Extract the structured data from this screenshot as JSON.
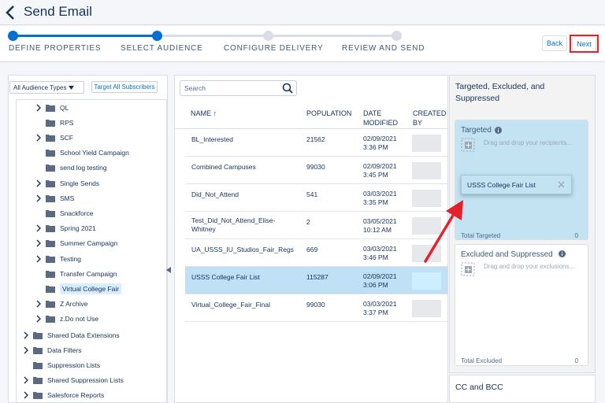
{
  "header": {
    "title": "Send Email"
  },
  "steps": [
    {
      "label": "DEFINE PROPERTIES",
      "state": "done"
    },
    {
      "label": "SELECT AUDIENCE",
      "state": "current"
    },
    {
      "label": "CONFIGURE DELIVERY",
      "state": "todo"
    },
    {
      "label": "REVIEW AND SEND",
      "state": "todo"
    }
  ],
  "actions": {
    "back_label": "Back",
    "next_label": "Next"
  },
  "tree": {
    "audience_select": "All Audience Types",
    "target_all_label": "Target All Subscribers",
    "items": [
      {
        "label": "QL",
        "expandable": true
      },
      {
        "label": "RPS",
        "expandable": false
      },
      {
        "label": "SCF",
        "expandable": true
      },
      {
        "label": "School Yield Campaign",
        "expandable": false
      },
      {
        "label": "send log testing",
        "expandable": false
      },
      {
        "label": "Single Sends",
        "expandable": true
      },
      {
        "label": "SMS",
        "expandable": true
      },
      {
        "label": "Snackforce",
        "expandable": false
      },
      {
        "label": "Spring 2021",
        "expandable": true
      },
      {
        "label": "Summer Campaign",
        "expandable": true
      },
      {
        "label": "Testing",
        "expandable": true
      },
      {
        "label": "Transfer Campaign",
        "expandable": false
      },
      {
        "label": "Virtual College Fair",
        "expandable": false,
        "selected": true
      },
      {
        "label": "Z Archive",
        "expandable": true
      },
      {
        "label": "z.Do not Use",
        "expandable": true
      }
    ],
    "root_items": [
      {
        "label": "Shared Data Extensions",
        "expandable": true
      },
      {
        "label": "Data Filters",
        "expandable": true
      },
      {
        "label": "Suppression Lists",
        "expandable": false
      },
      {
        "label": "Shared Suppression Lists",
        "expandable": true
      },
      {
        "label": "Salesforce Reports",
        "expandable": true
      }
    ]
  },
  "list": {
    "search_placeholder": "Search",
    "columns": {
      "name": "NAME",
      "population": "POPULATION",
      "date_line1": "DATE",
      "date_line2": "MODIFIED",
      "created_line1": "CREATED",
      "created_line2": "BY"
    },
    "rows": [
      {
        "name_line1": "BL_Interested",
        "name_line2": "",
        "population": "21562",
        "date": "02/09/2021",
        "time": "3:36 PM"
      },
      {
        "name_line1": "Combined Campuses",
        "name_line2": "",
        "population": "99030",
        "date": "02/09/2021",
        "time": "3:45 PM"
      },
      {
        "name_line1": "Did_Not_Attend",
        "name_line2": "",
        "population": "541",
        "date": "03/03/2021",
        "time": "3:35 PM"
      },
      {
        "name_line1": "Test_Did_Not_Attend_Elise-",
        "name_line2": "Whitney",
        "population": "2",
        "date": "03/05/2021",
        "time": "10:12 AM"
      },
      {
        "name_line1": "UA_USSS_IU_Studios_Fair_Regs",
        "name_line2": "",
        "population": "669",
        "date": "03/03/2021",
        "time": "3:46 PM"
      },
      {
        "name_line1": "USSS College Fair List",
        "name_line2": "",
        "population": "115287",
        "date": "02/09/2021",
        "time": "3:06 PM",
        "selected": true
      },
      {
        "name_line1": "Virtual_College_Fair_Final",
        "name_line2": "",
        "population": "99030",
        "date": "03/03/2021",
        "time": "3:37 PM"
      }
    ]
  },
  "right": {
    "title": "Targeted, Excluded, and Suppressed",
    "targeted": {
      "title": "Targeted",
      "hint": "Drag and drop your recipients...",
      "total_label": "Total Targeted",
      "total_value": "0"
    },
    "excluded": {
      "title": "Excluded and Suppressed",
      "hint": "Drag and drop your exclusions...",
      "total_label": "Total Excluded",
      "total_value": "0"
    },
    "drag_card": "USSS College Fair List",
    "cc_label": "CC and BCC"
  },
  "colors": {
    "accent": "#0070d2",
    "highlight": "#e5202a",
    "target_bg": "#c3e3f3"
  }
}
